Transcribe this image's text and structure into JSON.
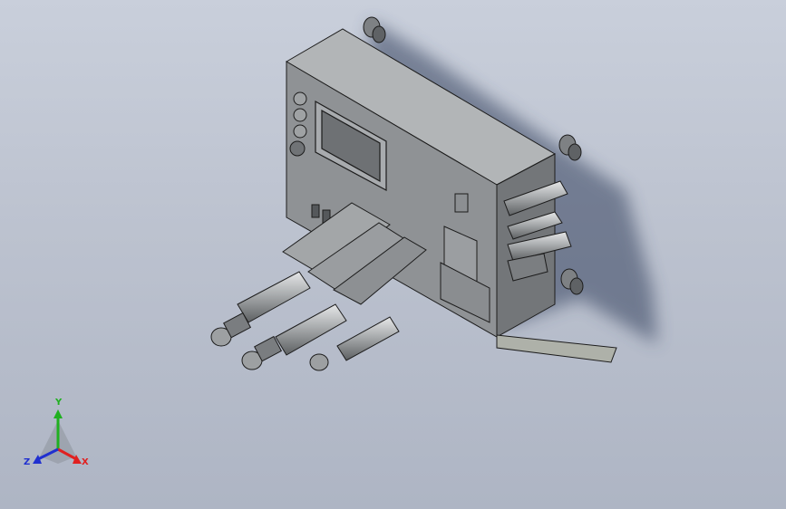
{
  "viewport": {
    "background_top": "#c9cfdb",
    "background_bottom": "#aeb5c4"
  },
  "model": {
    "body_color": "#8e9194",
    "body_dark": "#66696c",
    "body_light": "#b4b7b9",
    "edge_color": "#1c1c1c",
    "screen_color": "#6d7073",
    "shadow_color": "#3c4a68"
  },
  "triad": {
    "x_label": "X",
    "y_label": "Y",
    "z_label": "Z",
    "x_color": "#e02020",
    "y_color": "#20b020",
    "z_color": "#2030d0"
  }
}
